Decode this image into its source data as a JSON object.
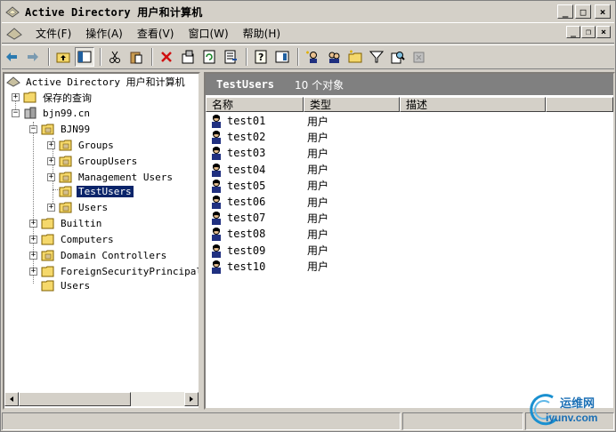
{
  "window": {
    "title": "Active Directory 用户和计算机",
    "caption_min": "_",
    "caption_max": "□",
    "caption_close": "×",
    "mdi_min": "_",
    "mdi_restore": "❐",
    "mdi_close": "×"
  },
  "menu": {
    "items": [
      "文件(F)",
      "操作(A)",
      "查看(V)",
      "窗口(W)",
      "帮助(H)"
    ]
  },
  "toolbar": {
    "icons": [
      "back-icon",
      "forward-icon",
      "up-folder-icon",
      "show-hide-tree-icon",
      "cut-icon",
      "paste-icon",
      "delete-icon",
      "properties-icon",
      "refresh-icon",
      "export-list-icon",
      "help-icon",
      "console-tree-icon",
      "new-user-icon",
      "new-group-icon",
      "new-ou-icon",
      "filter-icon",
      "find-icon",
      "add-to-group-icon"
    ]
  },
  "tree": {
    "root": "Active Directory 用户和计算机",
    "nodes": [
      {
        "label": "保存的查询",
        "expander": "+"
      },
      {
        "label": "bjn99.cn",
        "expander": "−"
      },
      {
        "label": "BJN99",
        "expander": "−"
      },
      {
        "label": "Groups",
        "expander": "+"
      },
      {
        "label": "GroupUsers",
        "expander": "+"
      },
      {
        "label": "Management Users",
        "expander": "+"
      },
      {
        "label": "TestUsers",
        "expander": ""
      },
      {
        "label": "Users",
        "expander": "+"
      },
      {
        "label": "Builtin",
        "expander": "+"
      },
      {
        "label": "Computers",
        "expander": "+"
      },
      {
        "label": "Domain Controllers",
        "expander": "+"
      },
      {
        "label": "ForeignSecurityPrincipals",
        "expander": "+"
      },
      {
        "label": "Users",
        "expander": ""
      }
    ]
  },
  "details": {
    "title": "TestUsers",
    "count": "10 个对象",
    "columns": [
      "名称",
      "类型",
      "描述"
    ],
    "rows": [
      {
        "name": "test01",
        "type": "用户"
      },
      {
        "name": "test02",
        "type": "用户"
      },
      {
        "name": "test03",
        "type": "用户"
      },
      {
        "name": "test04",
        "type": "用户"
      },
      {
        "name": "test05",
        "type": "用户"
      },
      {
        "name": "test06",
        "type": "用户"
      },
      {
        "name": "test07",
        "type": "用户"
      },
      {
        "name": "test08",
        "type": "用户"
      },
      {
        "name": "test09",
        "type": "用户"
      },
      {
        "name": "test10",
        "type": "用户"
      }
    ]
  },
  "watermark": {
    "cn": "运维网",
    "en": "iyunv.com"
  }
}
